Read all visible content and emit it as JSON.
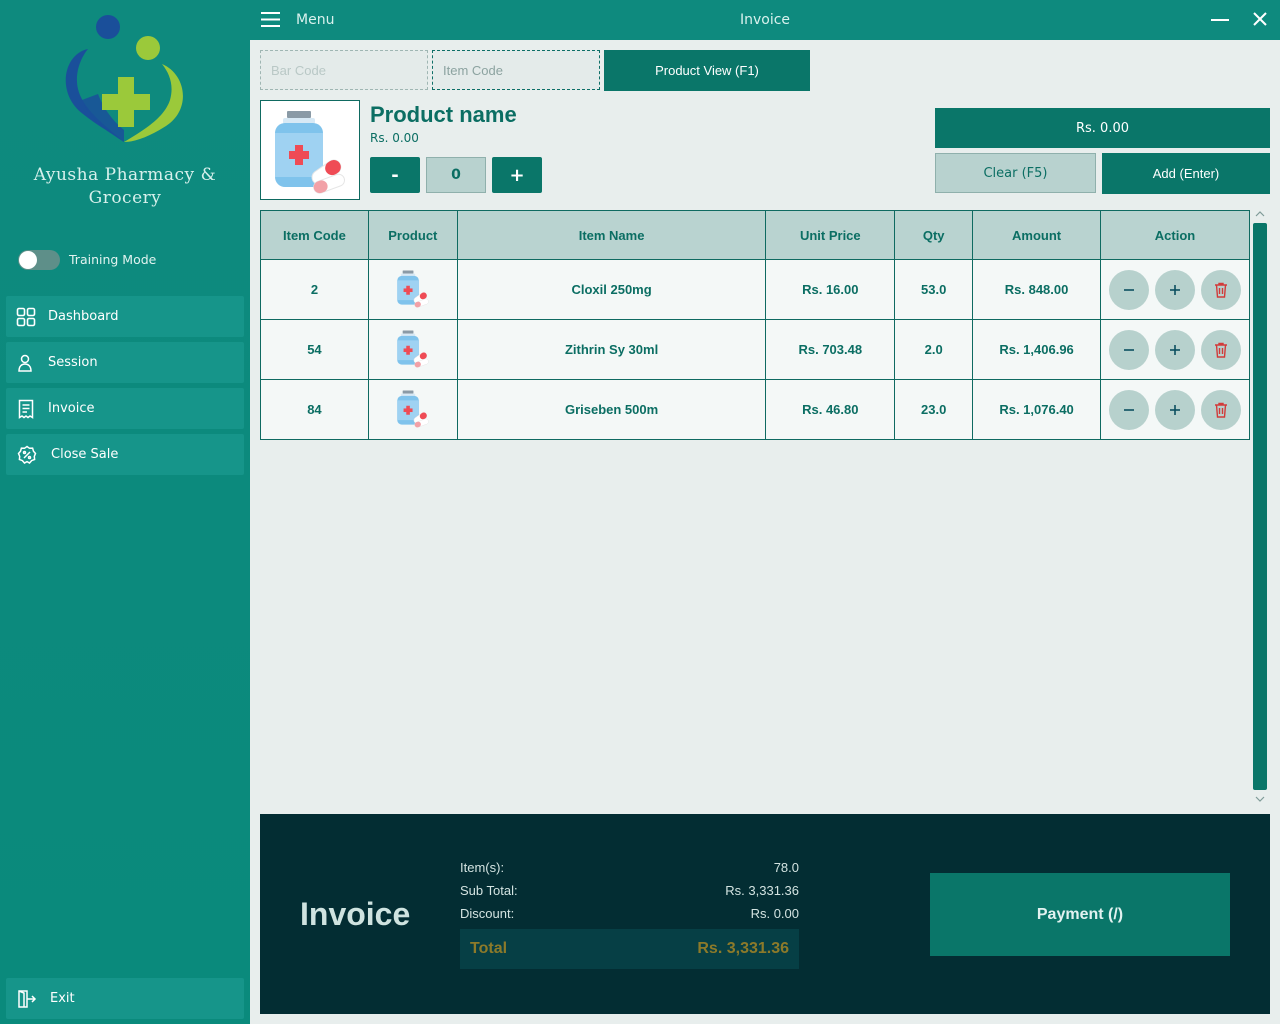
{
  "sidebar": {
    "brand_line1": "Ayusha Pharmacy  &",
    "brand_line2": "Grocery",
    "training_mode_label": "Training Mode",
    "items": [
      {
        "label": "Dashboard",
        "icon": "grid-icon"
      },
      {
        "label": "Session",
        "icon": "user-icon"
      },
      {
        "label": "Invoice",
        "icon": "receipt-icon"
      },
      {
        "label": "Close Sale",
        "icon": "percent-badge-icon"
      }
    ],
    "exit_label": "Exit"
  },
  "topbar": {
    "menu_label": "Menu",
    "title": "Invoice"
  },
  "search": {
    "barcode_placeholder": "Bar Code",
    "itemcode_placeholder": "Item Code",
    "product_view_label": "Product View (F1)"
  },
  "product": {
    "name": "Product name",
    "price": "Rs. 0.00",
    "qty": "0",
    "minus_label": "-",
    "plus_label": "+",
    "total": "Rs.  0.00",
    "clear_label": "Clear (F5)",
    "add_label": "Add (Enter)"
  },
  "table": {
    "headers": [
      "Item Code",
      "Product",
      "Item Name",
      "Unit Price",
      "Qty",
      "Amount",
      "Action"
    ],
    "rows": [
      {
        "code": "2",
        "name": "Cloxil 250mg",
        "unit_price": "Rs.  16.00",
        "qty": "53.0",
        "amount": "Rs.  848.00"
      },
      {
        "code": "54",
        "name": "Zithrin Sy 30ml",
        "unit_price": "Rs.  703.48",
        "qty": "2.0",
        "amount": "Rs.  1,406.96"
      },
      {
        "code": "84",
        "name": "Griseben 500m",
        "unit_price": "Rs.  46.80",
        "qty": "23.0",
        "amount": "Rs.  1,076.40"
      }
    ]
  },
  "summary": {
    "heading": "Invoice",
    "items_label": "Item(s):",
    "items_value": "78.0",
    "subtotal_label": "Sub Total:",
    "subtotal_value": "Rs.  3,331.36",
    "discount_label": "Discount:",
    "discount_value": "Rs.  0.00",
    "total_label": "Total",
    "total_value": "Rs.  3,331.36",
    "payment_label": "Payment (/)"
  },
  "colors": {
    "sidebar": "#0e8a7e",
    "accent": "#0a7669",
    "footer": "#032d33",
    "delete": "#d23a3a",
    "total_text": "#8c7a2a"
  }
}
